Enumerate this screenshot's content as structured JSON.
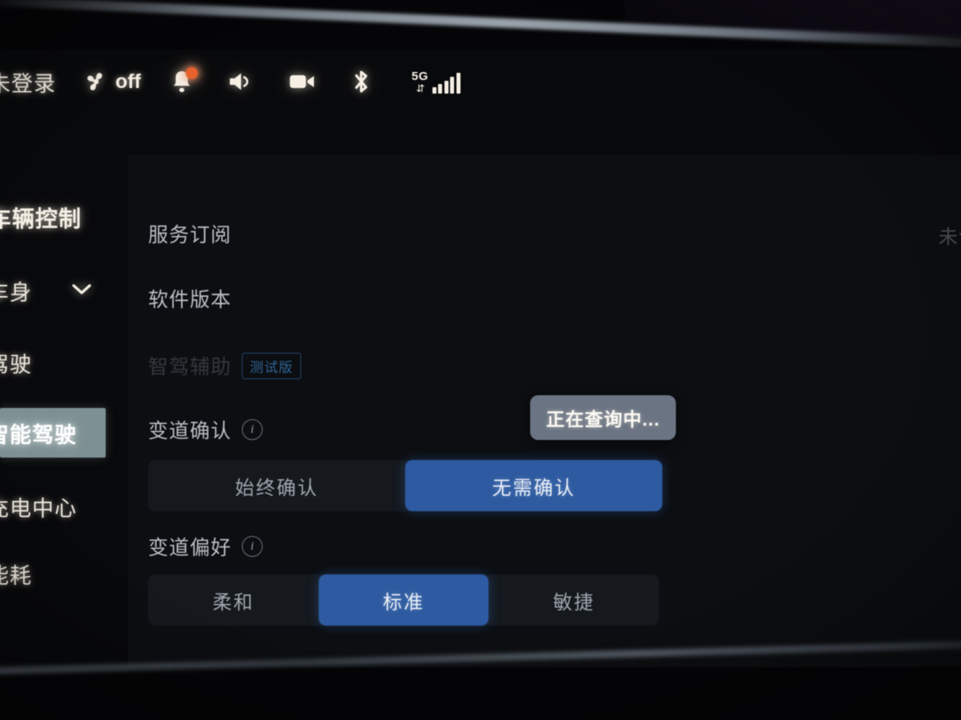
{
  "status_bar": {
    "login_text": "未登录",
    "fan_state": "off",
    "icons": [
      {
        "name": "fan-icon",
        "label": "fan"
      },
      {
        "name": "bell-icon",
        "label": "notifications",
        "badge": true
      },
      {
        "name": "volume-icon",
        "label": "volume"
      },
      {
        "name": "camera-icon",
        "label": "camera"
      },
      {
        "name": "bluetooth-icon",
        "label": "bluetooth"
      },
      {
        "name": "signal-icon",
        "label": "5G signal"
      }
    ],
    "network_label": "5G",
    "network_arrows": "⇅",
    "signal_bars": 5,
    "badge_color": "#e8622e"
  },
  "sidebar": {
    "title": "车辆控制",
    "items": [
      {
        "label": "车身",
        "has_chevron": true,
        "selected": false
      },
      {
        "label": "驾驶",
        "has_chevron": false,
        "selected": false
      },
      {
        "label": "智能驾驶",
        "has_chevron": false,
        "selected": true
      },
      {
        "label": "充电中心",
        "has_chevron": false,
        "selected": false
      },
      {
        "label": "能耗",
        "has_chevron": false,
        "selected": false
      }
    ],
    "selected_color": "#7d9093"
  },
  "content": {
    "service_subscription": "服务订阅",
    "service_subscription_status": "未订阅",
    "software_version": "软件版本",
    "assist_label": "智驾辅助",
    "assist_badge": "测试版",
    "lane_confirm": {
      "label": "变道确认",
      "options": [
        "始终确认",
        "无需确认"
      ],
      "selected": "无需确认"
    },
    "lane_preference": {
      "label": "变道偏好",
      "options": [
        "柔和",
        "标准",
        "敏捷"
      ],
      "selected": "标准"
    },
    "tooltip": "正在查询中...",
    "accent_color": "#2d5aa0",
    "tooltip_color": "#6a7483"
  }
}
